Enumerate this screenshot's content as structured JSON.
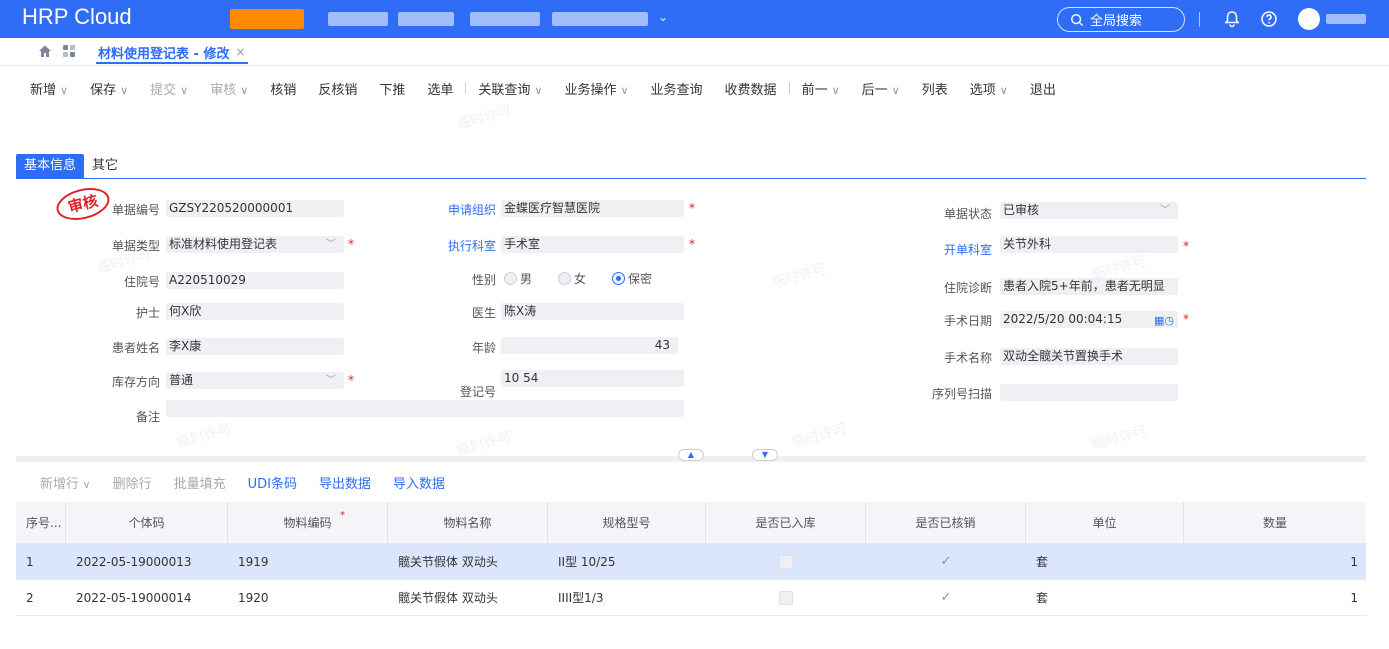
{
  "header": {
    "brand": "HRP Cloud",
    "search_label": "全局搜索",
    "accent": "#2f6df6",
    "icons": [
      "search-icon",
      "bell-icon",
      "help-icon",
      "user-avatar"
    ]
  },
  "tabbar": {
    "doc_tab": "材料使用登记表 - 修改",
    "close": "×"
  },
  "toolbar": {
    "items": [
      {
        "label": "新增",
        "caret": true,
        "disabled": false
      },
      {
        "label": "保存",
        "caret": true,
        "disabled": false
      },
      {
        "label": "提交",
        "caret": true,
        "disabled": true
      },
      {
        "label": "审核",
        "caret": true,
        "disabled": true
      },
      {
        "label": "核销",
        "caret": false,
        "disabled": false
      },
      {
        "label": "反核销",
        "caret": false,
        "disabled": false
      },
      {
        "label": "下推",
        "caret": false,
        "disabled": false
      },
      {
        "label": "选单",
        "caret": false,
        "disabled": false,
        "sep_after": true
      },
      {
        "label": "关联查询",
        "caret": true,
        "disabled": false
      },
      {
        "label": "业务操作",
        "caret": true,
        "disabled": false
      },
      {
        "label": "业务查询",
        "caret": false,
        "disabled": false
      },
      {
        "label": "收费数据",
        "caret": false,
        "disabled": false,
        "sep_after": true
      },
      {
        "label": "前一",
        "caret": true,
        "disabled": false
      },
      {
        "label": "后一",
        "caret": true,
        "disabled": false
      },
      {
        "label": "列表",
        "caret": false,
        "disabled": false
      },
      {
        "label": "选项",
        "caret": true,
        "disabled": false
      },
      {
        "label": "退出",
        "caret": false,
        "disabled": false
      }
    ]
  },
  "section_tabs": [
    "基本信息",
    "其它"
  ],
  "stamp": "审核",
  "watermark": "临时许可",
  "form": {
    "bill_no_label": "单据编号",
    "bill_no": "GZSY220520000001",
    "bill_type_label": "单据类型",
    "bill_type": "标准材料使用登记表",
    "inpatient_no_label": "住院号",
    "inpatient_no": "A220510029",
    "nurse_label": "护士",
    "nurse": "何X欣",
    "patient_name_label": "患者姓名",
    "patient_name": "李X康",
    "stock_dir_label": "库存方向",
    "stock_dir": "普通",
    "remark_label": "备注",
    "remark": "",
    "apply_org_label": "申请组织",
    "apply_org": "金蝶医疗智慧医院",
    "exec_dept_label": "执行科室",
    "exec_dept": "手术室",
    "gender_label": "性别",
    "gender_options": [
      "男",
      "女",
      "保密"
    ],
    "gender_selected": 2,
    "doctor_label": "医生",
    "doctor": "陈X涛",
    "age_label": "年龄",
    "age": "43",
    "reg_no_label": "登记号",
    "reg_no": "10     54",
    "status_label": "单据状态",
    "status": "已审核",
    "open_dept_label": "开单科室",
    "open_dept": "关节外科",
    "diagnosis_label": "住院诊断",
    "diagnosis": "患者入院5+年前，患者无明显",
    "surgery_date_label": "手术日期",
    "surgery_date": "2022/5/20 00:04:15",
    "surgery_name_label": "手术名称",
    "surgery_name": "双动全髋关节置换手术",
    "serial_scan_label": "序列号扫描",
    "serial_scan": ""
  },
  "detail_toolbar": [
    {
      "label": "新增行",
      "caret": true,
      "style": "disabled"
    },
    {
      "label": "删除行",
      "style": "disabled"
    },
    {
      "label": "批量填充",
      "style": "disabled"
    },
    {
      "label": "UDI条码",
      "style": "link"
    },
    {
      "label": "导出数据",
      "style": "link"
    },
    {
      "label": "导入数据",
      "style": "link"
    }
  ],
  "table": {
    "columns": [
      "序号...",
      "个体码",
      "物料编码",
      "物料名称",
      "规格型号",
      "是否已入库",
      "是否已核销",
      "单位",
      "数量"
    ],
    "rows": [
      {
        "seq": "1",
        "code": "2022-05-19000013",
        "material_no": "1919",
        "material_name": "髋关节假体 双动头",
        "spec": "II型 10/25",
        "in_stock": false,
        "written_off": true,
        "unit": "套",
        "qty": "1"
      },
      {
        "seq": "2",
        "code": "2022-05-19000014",
        "material_no": "1920",
        "material_name": "髋关节假体 双动头",
        "spec": "IIII型1/3",
        "in_stock": false,
        "written_off": true,
        "unit": "套",
        "qty": "1"
      }
    ]
  }
}
